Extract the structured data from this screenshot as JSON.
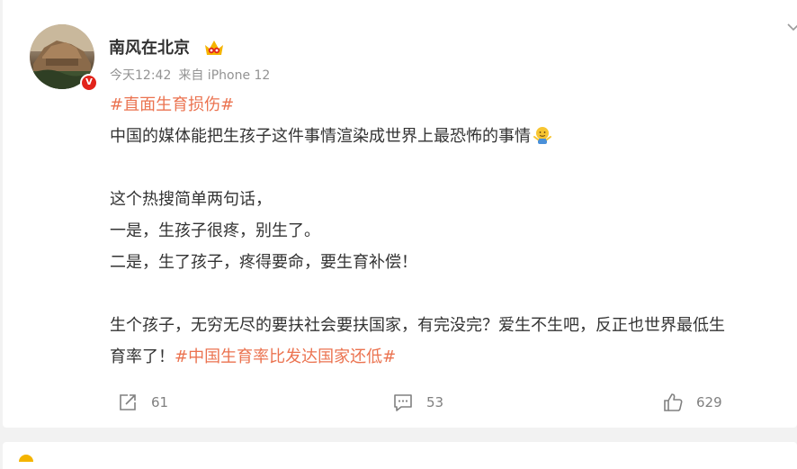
{
  "post": {
    "author": "南风在北京",
    "verified_badge": "V",
    "time": "今天12:42",
    "source": "来自 iPhone 12",
    "lines": [
      {
        "segments": [
          {
            "text": "#直面生育损伤#",
            "tag": true
          }
        ]
      },
      {
        "segments": [
          {
            "text": "中国的媒体能把生孩子这件事情渲染成世界上最恐怖的事情",
            "tag": false
          }
        ],
        "emoji": "shrug-emoji"
      },
      {
        "blank": true
      },
      {
        "segments": [
          {
            "text": "这个热搜简单两句话，",
            "tag": false
          }
        ]
      },
      {
        "segments": [
          {
            "text": "一是，生孩子很疼，别生了。",
            "tag": false
          }
        ]
      },
      {
        "segments": [
          {
            "text": "二是，生了孩子，疼得要命，要生育补偿！",
            "tag": false
          }
        ]
      },
      {
        "blank": true
      },
      {
        "segments": [
          {
            "text": "生个孩子，无穷无尽的要扶社会要扶国家，有完没完？爱生不生吧，反正也世界最低生",
            "tag": false
          }
        ]
      },
      {
        "segments": [
          {
            "text": "育率了！",
            "tag": false
          },
          {
            "text": "#中国生育率比发达国家还低#",
            "tag": true
          }
        ]
      }
    ]
  },
  "actions": {
    "forward_count": "61",
    "comment_count": "53",
    "like_count": "629"
  },
  "colors": {
    "topic_tag": "#eb7350",
    "meta_text": "#939393",
    "verified": "#e2231a"
  },
  "icons": {
    "vip": "crown-vip-icon",
    "forward": "forward-icon",
    "comment": "comment-icon",
    "like": "thumbs-up-icon",
    "more": "chevron-down-icon"
  }
}
